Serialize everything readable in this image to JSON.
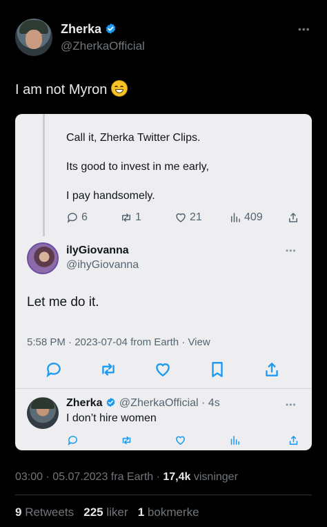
{
  "author": {
    "name": "Zherka",
    "handle": "@ZherkaOfficial",
    "verified": true,
    "more_icon": "more-horizontal-icon"
  },
  "tweet": {
    "text": "I am not Myron",
    "emoji": "grinning-squinting-face"
  },
  "embedded_screenshot": {
    "thread": {
      "lines": [
        "Call it, Zherka Twitter Clips.",
        "Its good to invest in me early,",
        "I pay handsomely."
      ],
      "stats": {
        "replies": "6",
        "retweets": "1",
        "likes": "21",
        "views": "409"
      }
    },
    "reply": {
      "name": "ilyGiovanna",
      "handle": "@ihyGiovanna",
      "text": "Let me do it.",
      "meta": "5:58 PM · 2023-07-04 from Earth · View"
    },
    "sub_reply": {
      "name": "Zherka",
      "handle": "@ZherkaOfficial",
      "time": "· 4s",
      "text": "I don’t hire women"
    }
  },
  "footer": {
    "time": "03:00",
    "date": "05.07.2023",
    "source": "fra Earth",
    "views": "17,4k",
    "views_label": "visninger",
    "retweets": "9",
    "retweets_label": "Retweets",
    "likes": "225",
    "likes_label": "liker",
    "bookmarks": "1",
    "bookmarks_label": "bokmerke"
  },
  "colors": {
    "background": "#000000",
    "text": "#e7e9ea",
    "muted": "#71767b",
    "verified": "#1d9bf0",
    "card": "#eeeef0"
  }
}
